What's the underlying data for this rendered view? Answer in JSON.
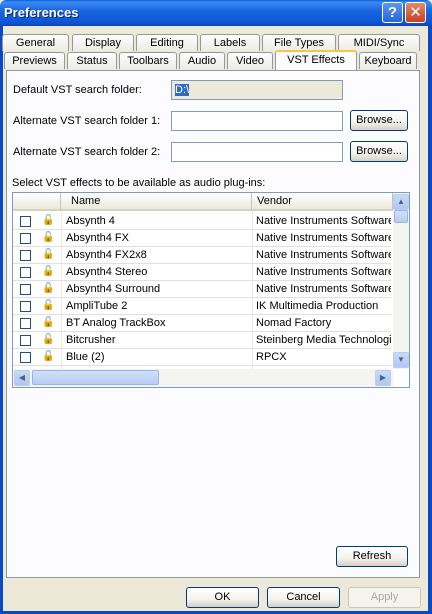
{
  "window": {
    "title": "Preferences",
    "help_glyph": "?",
    "close_glyph": "✕"
  },
  "tabs_row1": [
    "General",
    "Display",
    "Editing",
    "Labels",
    "File Types",
    "MIDI/Sync"
  ],
  "tabs_row2": [
    "Previews",
    "Status",
    "Toolbars",
    "Audio",
    "Video",
    "VST Effects",
    "Keyboard"
  ],
  "active_tab": "VST Effects",
  "vst": {
    "default_label": "Default VST search folder:",
    "default_value": "D:\\",
    "alt1_label": "Alternate VST search folder 1:",
    "alt1_value": "",
    "alt2_label": "Alternate VST search folder 2:",
    "alt2_value": "",
    "browse_label": "Browse...",
    "list_label": "Select VST effects to be available as audio plug-ins:",
    "columns": [
      "Name",
      "Vendor"
    ],
    "rows": [
      {
        "name": "Absynth 4",
        "vendor": "Native Instruments Software"
      },
      {
        "name": "Absynth4 FX",
        "vendor": "Native Instruments Software"
      },
      {
        "name": "Absynth4 FX2x8",
        "vendor": "Native Instruments Software"
      },
      {
        "name": "Absynth4 Stereo",
        "vendor": "Native Instruments Software"
      },
      {
        "name": "Absynth4 Surround",
        "vendor": "Native Instruments Software"
      },
      {
        "name": "AmpliTube 2",
        "vendor": "IK Multimedia Production"
      },
      {
        "name": "BT Analog TrackBox",
        "vendor": "Nomad Factory"
      },
      {
        "name": "Bitcrusher",
        "vendor": "Steinberg Media Technologies"
      },
      {
        "name": "Blue (2)",
        "vendor": "RPCX"
      }
    ],
    "refresh_label": "Refresh"
  },
  "footer": {
    "ok_label": "OK",
    "cancel_label": "Cancel",
    "apply_label": "Apply"
  }
}
